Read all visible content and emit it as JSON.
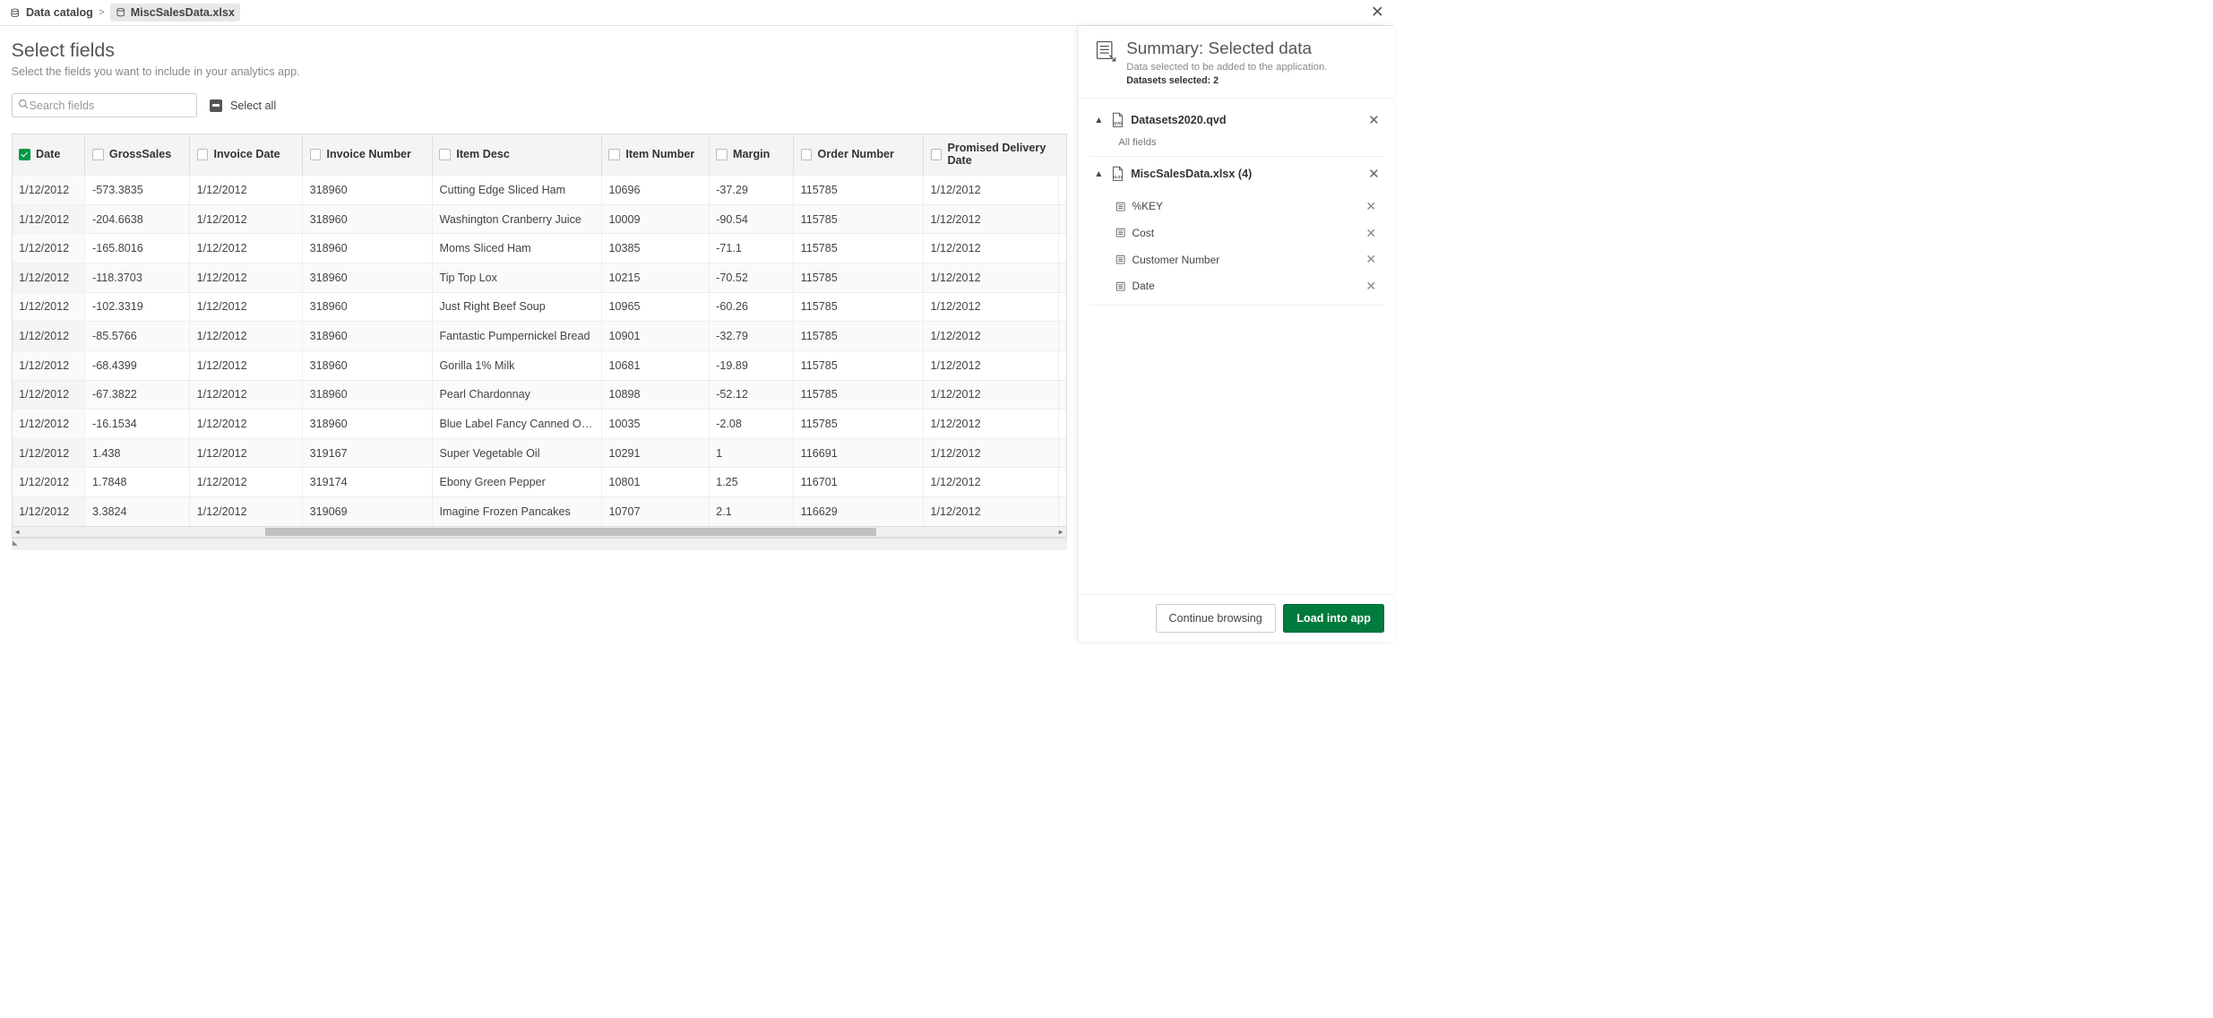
{
  "breadcrumb": {
    "root": "Data catalog",
    "current": "MiscSalesData.xlsx"
  },
  "page": {
    "title": "Select fields",
    "subtitle": "Select the fields you want to include in your analytics app."
  },
  "search": {
    "placeholder": "Search fields"
  },
  "select_all": "Select all",
  "columns": [
    {
      "label": "Date",
      "checked": true
    },
    {
      "label": "GrossSales",
      "checked": false
    },
    {
      "label": "Invoice Date",
      "checked": false
    },
    {
      "label": "Invoice Number",
      "checked": false
    },
    {
      "label": "Item Desc",
      "checked": false
    },
    {
      "label": "Item Number",
      "checked": false
    },
    {
      "label": "Margin",
      "checked": false
    },
    {
      "label": "Order Number",
      "checked": false
    },
    {
      "label": "Promised Delivery Date",
      "checked": false
    }
  ],
  "rows": [
    [
      "1/12/2012",
      "-573.3835",
      "1/12/2012",
      "318960",
      "Cutting Edge Sliced Ham",
      "10696",
      "-37.29",
      "115785",
      "1/12/2012"
    ],
    [
      "1/12/2012",
      "-204.6638",
      "1/12/2012",
      "318960",
      "Washington Cranberry Juice",
      "10009",
      "-90.54",
      "115785",
      "1/12/2012"
    ],
    [
      "1/12/2012",
      "-165.8016",
      "1/12/2012",
      "318960",
      "Moms Sliced Ham",
      "10385",
      "-71.1",
      "115785",
      "1/12/2012"
    ],
    [
      "1/12/2012",
      "-118.3703",
      "1/12/2012",
      "318960",
      "Tip Top Lox",
      "10215",
      "-70.52",
      "115785",
      "1/12/2012"
    ],
    [
      "1/12/2012",
      "-102.3319",
      "1/12/2012",
      "318960",
      "Just Right Beef Soup",
      "10965",
      "-60.26",
      "115785",
      "1/12/2012"
    ],
    [
      "1/12/2012",
      "-85.5766",
      "1/12/2012",
      "318960",
      "Fantastic Pumpernickel Bread",
      "10901",
      "-32.79",
      "115785",
      "1/12/2012"
    ],
    [
      "1/12/2012",
      "-68.4399",
      "1/12/2012",
      "318960",
      "Gorilla 1% Milk",
      "10681",
      "-19.89",
      "115785",
      "1/12/2012"
    ],
    [
      "1/12/2012",
      "-67.3822",
      "1/12/2012",
      "318960",
      "Pearl Chardonnay",
      "10898",
      "-52.12",
      "115785",
      "1/12/2012"
    ],
    [
      "1/12/2012",
      "-16.1534",
      "1/12/2012",
      "318960",
      "Blue Label Fancy Canned Oysters",
      "10035",
      "-2.08",
      "115785",
      "1/12/2012"
    ],
    [
      "1/12/2012",
      "1.438",
      "1/12/2012",
      "319167",
      "Super Vegetable Oil",
      "10291",
      "1",
      "116691",
      "1/12/2012"
    ],
    [
      "1/12/2012",
      "1.7848",
      "1/12/2012",
      "319174",
      "Ebony Green Pepper",
      "10801",
      "1.25",
      "116701",
      "1/12/2012"
    ],
    [
      "1/12/2012",
      "3.3824",
      "1/12/2012",
      "319069",
      "Imagine Frozen Pancakes",
      "10707",
      "2.1",
      "116629",
      "1/12/2012"
    ]
  ],
  "summary": {
    "title": "Summary: Selected data",
    "subtitle": "Data selected to be added to the application.",
    "count_label": "Datasets selected: 2"
  },
  "datasets": [
    {
      "name": "Datasets2020.qvd",
      "type": "qvd",
      "detail": "All fields",
      "fields": []
    },
    {
      "name": "MiscSalesData.xlsx (4)",
      "type": "xlsx",
      "detail": "",
      "fields": [
        "%KEY",
        "Cost",
        "Customer Number",
        "Date"
      ]
    }
  ],
  "buttons": {
    "continue": "Continue browsing",
    "load": "Load into app"
  }
}
